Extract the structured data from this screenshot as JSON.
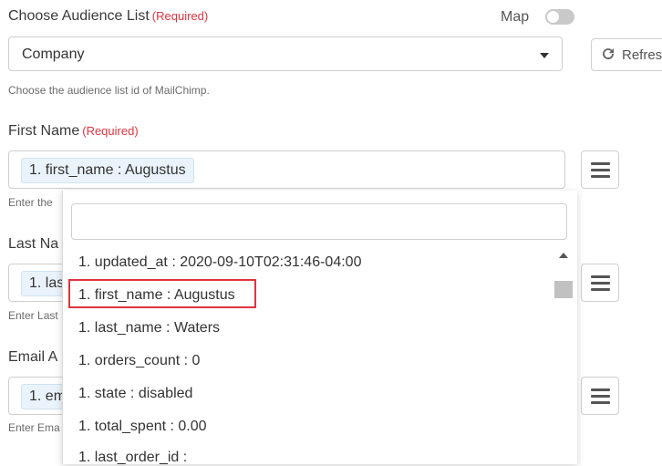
{
  "audience": {
    "label": "Choose Audience List",
    "required": "(Required)",
    "selected": "Company",
    "help": "Choose the audience list id of MailChimp.",
    "refresh_label": "Refresh",
    "map_label": "Map"
  },
  "first_name": {
    "label": "First Name",
    "required": "(Required)",
    "chip": "1. first_name : Augustus",
    "help": "Enter the"
  },
  "last_name": {
    "label": "Last Na",
    "chip": "1. las",
    "help": "Enter Last"
  },
  "email": {
    "label": "Email A",
    "chip": "1. em",
    "help": "Enter Ema"
  },
  "dropdown": {
    "search_value": "",
    "items": [
      "1. updated_at : 2020-09-10T02:31:46-04:00",
      "1. first_name : Augustus",
      "1. last_name : Waters",
      "1. orders_count : 0",
      "1. state : disabled",
      "1. total_spent : 0.00",
      "1. last_order_id : "
    ],
    "highlighted_index": 1
  },
  "colors": {
    "required": "#e0343f",
    "chip_bg": "#eaf3fb",
    "highlight_border": "#e0343f"
  }
}
